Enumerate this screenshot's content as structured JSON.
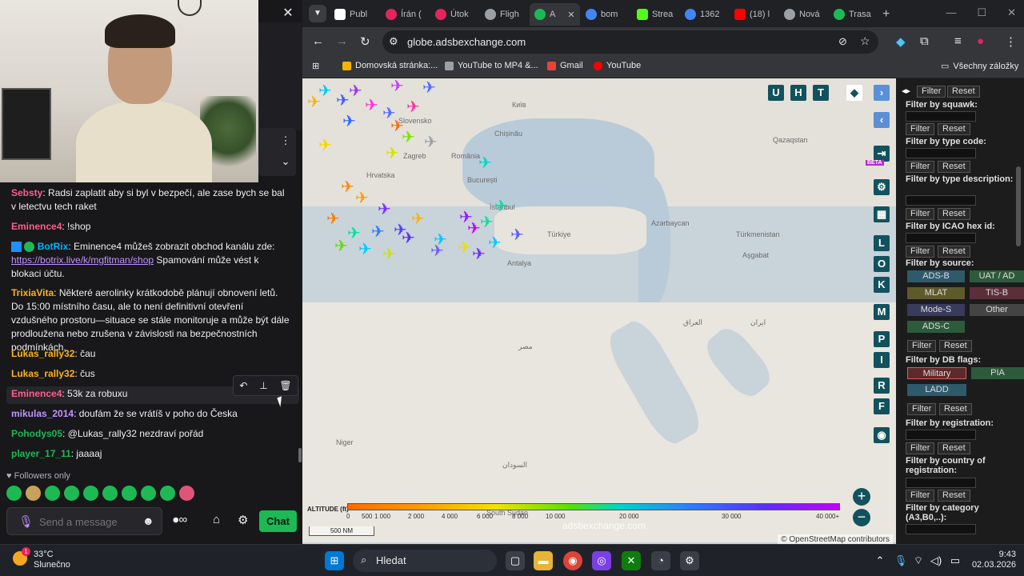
{
  "stream": {
    "close_label": "✕",
    "chat_messages": [
      {
        "user": "Sebsty",
        "color": "#ff5e8b",
        "text": "Radsi zaplatit aby si byl v bezpečí, ale zase bych se bal v letectvu tech raket"
      },
      {
        "user": "Eminence4",
        "color": "#ff5e8b",
        "text": "!shop"
      },
      {
        "user": "BotRix",
        "color": "#00b4ff",
        "text": "Eminence4 můžeš zobrazit obchod kanálu zde:",
        "link": "https://botrix.live/k/mgfitman/shop",
        "after": "Spamování může vést k blokaci účtu."
      },
      {
        "user": "TrixiaVita",
        "color": "#ffb31a",
        "text": "Některé aerolinky krátkodobě plánují obnovení letů. Do 15:00 místního času, ale to není definitivní otevření vzdušného prostoru—situace se stále monitoruje a může být dále prodloužena nebo zrušena v závislosti na bezpečnostních podmínkách."
      },
      {
        "user": "Lukas_rally32",
        "color": "#ffb31a",
        "text": "čau"
      },
      {
        "user": "Lukas_rally32",
        "color": "#ffb31a",
        "text": "čus"
      },
      {
        "user": "Eminence4",
        "color": "#ff5e8b",
        "text": "53k za robuxu"
      },
      {
        "user": "mikulas_2014",
        "color": "#bf94ff",
        "text": "doufám že se vrátíš v poho do Česka"
      },
      {
        "user": "Pohodys05",
        "color": "#1db954",
        "text": "@Lukas_rally32 nezdraví pořád"
      },
      {
        "user": "player_17_11",
        "color": "#1db954",
        "text": "jaaaaj"
      }
    ],
    "followers_only": "Followers only",
    "send_placeholder": "Send a message",
    "chat_button": "Chat",
    "colors": {
      "accent": "#1db954",
      "bg": "#18181b"
    }
  },
  "browser": {
    "tabs": [
      {
        "label": "Publ",
        "icon_color": "#ffffff"
      },
      {
        "label": "Írán (",
        "icon_color": "#e6245c"
      },
      {
        "label": "Útok",
        "icon_color": "#e6245c"
      },
      {
        "label": "Fligh",
        "icon_color": "#9aa0a6"
      },
      {
        "label": "A",
        "icon_color": "#1db954"
      },
      {
        "label": "bom",
        "icon_color": "#4285f4"
      },
      {
        "label": "Strea",
        "icon_color": "#53fc18"
      },
      {
        "label": "1362",
        "icon_color": "#4285f4"
      },
      {
        "label": "(18) l",
        "icon_color": "#ff0000"
      },
      {
        "label": "Nová",
        "icon_color": "#9aa0a6"
      },
      {
        "label": "Trasa",
        "icon_color": "#1db954"
      }
    ],
    "new_tab": "+",
    "url": "globe.adsbexchange.com",
    "bookmarks": [
      {
        "label": "Domovská stránka:...",
        "color": "#f4b400"
      },
      {
        "label": "YouTube to MP4 &...",
        "color": "#9aa0a6"
      },
      {
        "label": "Gmail",
        "color": "#ea4335"
      },
      {
        "label": "YouTube",
        "color": "#ff0000"
      }
    ],
    "all_bookmarks": "Všechny záložky"
  },
  "map": {
    "top_buttons": [
      "U",
      "H",
      "T"
    ],
    "side_buttons": [
      "L",
      "O",
      "K",
      "M",
      "P",
      "I",
      "R",
      "F"
    ],
    "beta_label": "BETA",
    "labels": [
      "Київ",
      "Chișinău",
      "Slovensko",
      "România",
      "București",
      "Zagreb",
      "Hrvatska",
      "İstanbul",
      "Türkiye",
      "Antalya",
      "Azərbaycan",
      "Qazaqstan",
      "Türkmenistan",
      "Aşgabat",
      "Niger",
      "السودان",
      "South Sudan",
      "مصر",
      "العراق",
      "ایران"
    ],
    "altitude_label": "ALTITUDE (ft)",
    "altitude_ticks": [
      "0",
      "500",
      "1 000",
      "2 000",
      "4 000",
      "6 000",
      "8 000",
      "10 000",
      "20 000",
      "30 000",
      "40 000+"
    ],
    "scale": "500 NM",
    "watermark": "adsbexchange.com",
    "attribution": "© OpenStreetMap contributors",
    "zoom_in": "+",
    "zoom_out": "−"
  },
  "filters": {
    "filter_label": "Filter",
    "reset_label": "Reset",
    "squawk": "Filter by squawk:",
    "type_code": "Filter by type code:",
    "type_desc": "Filter by type description:",
    "icao": "Filter by ICAO hex id:",
    "source": "Filter by source:",
    "sources": [
      "ADS-B",
      "UAT / AD",
      "MLAT",
      "TIS-B",
      "Mode-S",
      "Other",
      "ADS-C"
    ],
    "db_flags": "Filter by DB flags:",
    "flags": [
      "Military",
      "PIA",
      "LADD"
    ],
    "registration": "Filter by registration:",
    "country": "Filter by country of registration:",
    "category": "Filter by category (A3,B0,..):"
  },
  "taskbar": {
    "temperature": "33°C",
    "weather": "Slunečno",
    "weather_badge": "1",
    "search": "Hledat",
    "time": "9:43",
    "date": "02.03.2026"
  }
}
